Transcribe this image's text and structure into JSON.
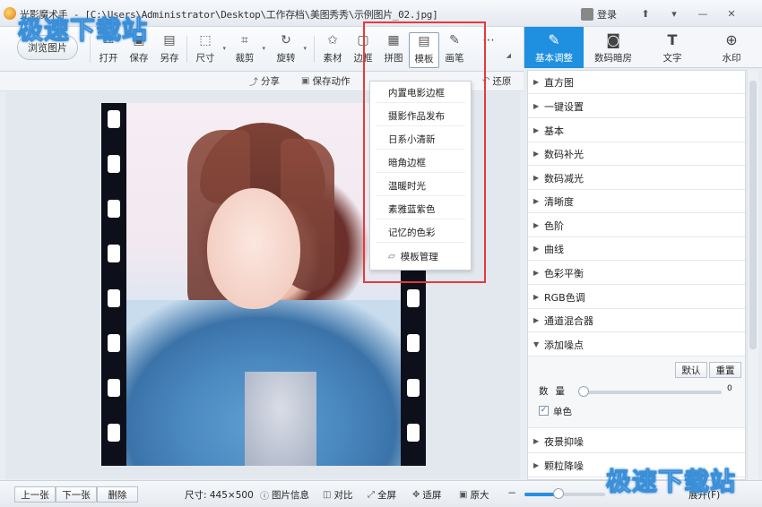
{
  "window": {
    "title": "光影魔术手 - [C:\\Users\\Administrator\\Desktop\\工作存档\\美图秀秀\\示例图片_02.jpg]",
    "login": "登录",
    "controls": [
      "⬆",
      "▾",
      "—",
      "✕"
    ]
  },
  "watermark": "极速下载站",
  "toolbar": {
    "browse": "浏览图片",
    "tools": [
      {
        "label": "打开",
        "icon": "open-icon"
      },
      {
        "label": "保存",
        "icon": "save-icon"
      },
      {
        "label": "另存",
        "icon": "save-as-icon"
      },
      {
        "label": "尺寸",
        "icon": "resize-icon"
      },
      {
        "label": "裁剪",
        "icon": "crop-icon"
      },
      {
        "label": "旋转",
        "icon": "rotate-icon"
      },
      {
        "label": "素材",
        "icon": "material-icon"
      },
      {
        "label": "边框",
        "icon": "border-icon"
      },
      {
        "label": "拼图",
        "icon": "collage-icon"
      },
      {
        "label": "模板",
        "icon": "template-icon"
      },
      {
        "label": "画笔",
        "icon": "brush-icon"
      },
      {
        "label": "",
        "icon": "more-icon"
      }
    ]
  },
  "subbar": {
    "share": "分享",
    "save_action": "保存动作",
    "restore": "还原"
  },
  "template_menu": {
    "items": [
      "内置电影边框",
      "摄影作品发布",
      "日系小清新",
      "暗角边框",
      "温暖时光",
      "素雅蓝紫色",
      "记忆的色彩"
    ],
    "manage": "模板管理"
  },
  "right_tabs": [
    {
      "label": "基本调整",
      "icon": "adjust-icon"
    },
    {
      "label": "数码暗房",
      "icon": "darkroom-icon"
    },
    {
      "label": "文字",
      "icon": "text-icon"
    },
    {
      "label": "水印",
      "icon": "watermark-icon"
    }
  ],
  "adjustments": {
    "items": [
      "直方图",
      "一键设置",
      "基本",
      "数码补光",
      "数码减光",
      "清晰度",
      "色阶",
      "曲线",
      "色彩平衡",
      "RGB色调",
      "通道混合器"
    ],
    "open_item": "添加噪点",
    "default_btn": "默认",
    "reset_btn": "重置",
    "amount_label": "数量",
    "amount_value": "0",
    "amount_fraction": 0,
    "mono_label": "单色",
    "mono_checked": "✓",
    "after_items": [
      "夜景抑噪",
      "颗粒降噪"
    ]
  },
  "bottombar": {
    "prev": "上一张",
    "next": "下一张",
    "delete": "删除",
    "size": "尺寸: 445×500",
    "info": "图片信息",
    "compare": "对比",
    "fullscreen": "全屏",
    "fit": "适屏",
    "original": "原大",
    "zoom_fraction": 0.42,
    "expand": "展开(F)"
  }
}
